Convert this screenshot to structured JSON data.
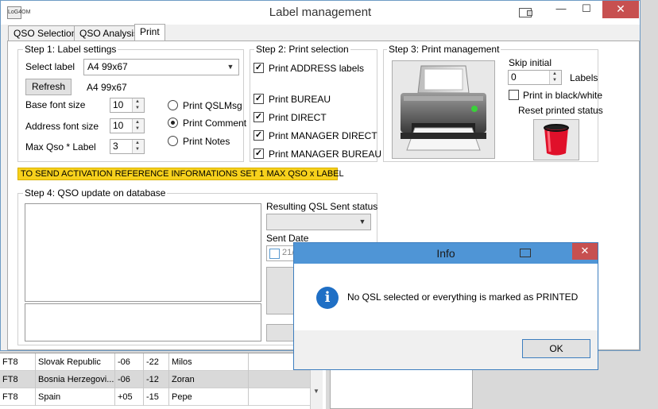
{
  "window": {
    "title": "Label management",
    "app_icon_text": "LoG4OM",
    "minimize": "—",
    "maximize": "☐",
    "close": "✕"
  },
  "tabs": [
    {
      "label": "QSO Selection"
    },
    {
      "label": "QSO Analysis"
    },
    {
      "label": "Print"
    }
  ],
  "step1": {
    "title": "Step 1: Label settings",
    "select_label": "Select label",
    "select_value": "A4 99x67",
    "refresh": "Refresh",
    "label_name": "A4 99x67",
    "base_font_label": "Base font size",
    "base_font_value": "10",
    "address_font_label": "Address font size",
    "address_font_value": "10",
    "max_qso_label": "Max Qso * Label",
    "max_qso_value": "3",
    "radios": [
      {
        "label": "Print QSLMsg",
        "checked": false
      },
      {
        "label": "Print Comment",
        "checked": true
      },
      {
        "label": "Print Notes",
        "checked": false
      }
    ]
  },
  "step2": {
    "title": "Step 2: Print selection",
    "checks": [
      {
        "label": "Print ADDRESS labels",
        "checked": true
      },
      {
        "label": "Print BUREAU",
        "checked": true
      },
      {
        "label": "Print DIRECT",
        "checked": true
      },
      {
        "label": "Print MANAGER DIRECT",
        "checked": true
      },
      {
        "label": "Print MANAGER BUREAU",
        "checked": true
      }
    ]
  },
  "step3": {
    "title": "Step 3: Print management",
    "skip_initial": "Skip initial",
    "skip_value": "0",
    "labels": "Labels",
    "bw_label": "Print in black/white",
    "reset_label": "Reset printed status"
  },
  "warning": "TO SEND ACTIVATION REFERENCE INFORMATIONS SET 1 MAX QSO x LABEL",
  "step4": {
    "title": "Step 4: QSO update on database",
    "qsl_status_label": "Resulting QSL Sent status",
    "sent_date_label": "Sent Date",
    "sent_date_value": "21/"
  },
  "grid": {
    "rows": [
      {
        "cells": [
          "FT8",
          "Slovak Republic",
          "-06",
          "-22",
          "Milos"
        ],
        "selected": false
      },
      {
        "cells": [
          "FT8",
          "Bosnia Herzegovi...",
          "-06",
          "-12",
          "Zoran"
        ],
        "selected": true
      },
      {
        "cells": [
          "FT8",
          "Spain",
          "+05",
          "-15",
          "Pepe"
        ],
        "selected": false
      }
    ]
  },
  "dialog": {
    "title": "Info",
    "close": "✕",
    "message": "No QSL selected or everything is marked as PRINTED",
    "ok": "OK"
  }
}
